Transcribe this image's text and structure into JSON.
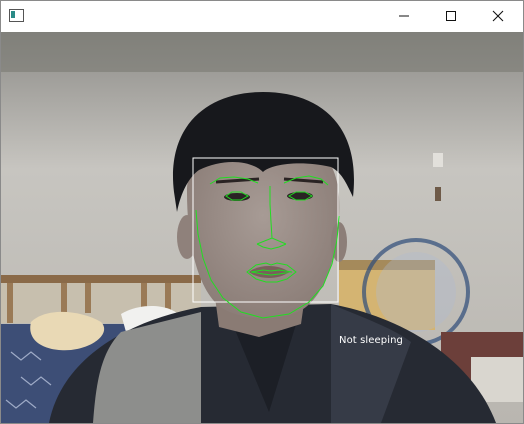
{
  "window": {
    "title": "",
    "controls": {
      "minimize": "minimize-icon",
      "maximize": "maximize-icon",
      "close": "close-icon"
    }
  },
  "video": {
    "status_label": "Not sleeping",
    "overlay_color": "#22dd22",
    "box_color": "#ffffff"
  }
}
